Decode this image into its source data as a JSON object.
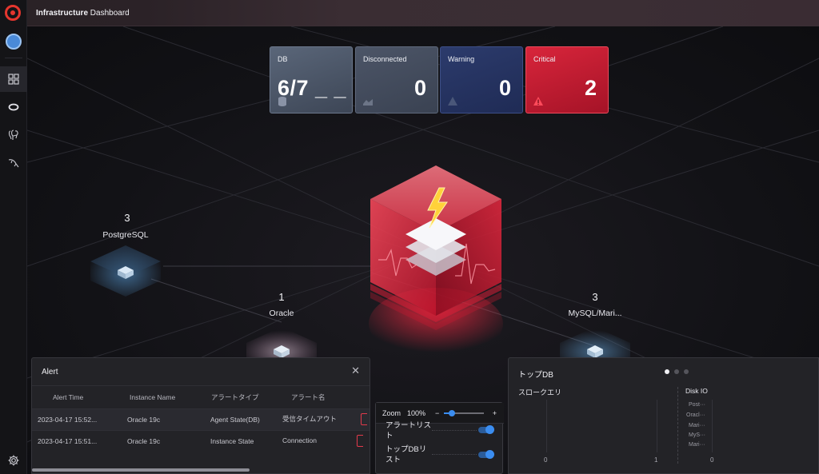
{
  "app": {
    "title_bold": "Infrastructure",
    "title_rest": " Dashboard"
  },
  "sidebar": {
    "items": [
      {
        "name": "dashboard-grid-icon",
        "active": true
      },
      {
        "name": "database-ring-icon",
        "active": false
      },
      {
        "name": "postgresql-icon",
        "active": false
      },
      {
        "name": "mysql-icon",
        "active": false
      }
    ],
    "settings_icon": "gear-icon"
  },
  "stats": {
    "db": {
      "label": "DB",
      "value": "6/7 _ _"
    },
    "disconnected": {
      "label": "Disconnected",
      "value": "0"
    },
    "warning": {
      "label": "Warning",
      "value": "0"
    },
    "critical": {
      "label": "Critical",
      "value": "2"
    }
  },
  "colors": {
    "critical": "#d8253b",
    "warning": "#2c3b6c",
    "accent": "#3b8df0"
  },
  "nodes": [
    {
      "id": "postgres",
      "count": "3",
      "name": "PostgreSQL"
    },
    {
      "id": "oracle",
      "count": "1",
      "name": "Oracle"
    },
    {
      "id": "mysql",
      "count": "3",
      "name": "MySQL/Mari..."
    }
  ],
  "alert_panel": {
    "title": "Alert",
    "columns": [
      "Alert Time",
      "Instance Name",
      "アラートタイプ",
      "アラート名"
    ],
    "rows": [
      [
        "2023-04-17 15:52...",
        "Oracle 19c",
        "Agent State(DB)",
        "受信タイムアウト"
      ],
      [
        "2023-04-17 15:51...",
        "Oracle 19c",
        "Instance State",
        "Connection"
      ]
    ]
  },
  "zoom": {
    "label": "Zoom",
    "value": "100%",
    "minus": "−",
    "plus": "+",
    "level": 0.2,
    "options": [
      {
        "label": "アラートリスト",
        "on": true
      },
      {
        "label": "トップDBリスト",
        "on": true
      }
    ]
  },
  "topdb": {
    "title": "トップDB",
    "slow_query": {
      "title": "スロークエリ",
      "ticks": [
        "0",
        "1"
      ]
    },
    "disk_io": {
      "title": "Disk IO",
      "labels": [
        "Post···",
        "Oracl···",
        "Mari···",
        "MyS···",
        "Mari···"
      ],
      "ticks": [
        "0"
      ]
    }
  }
}
